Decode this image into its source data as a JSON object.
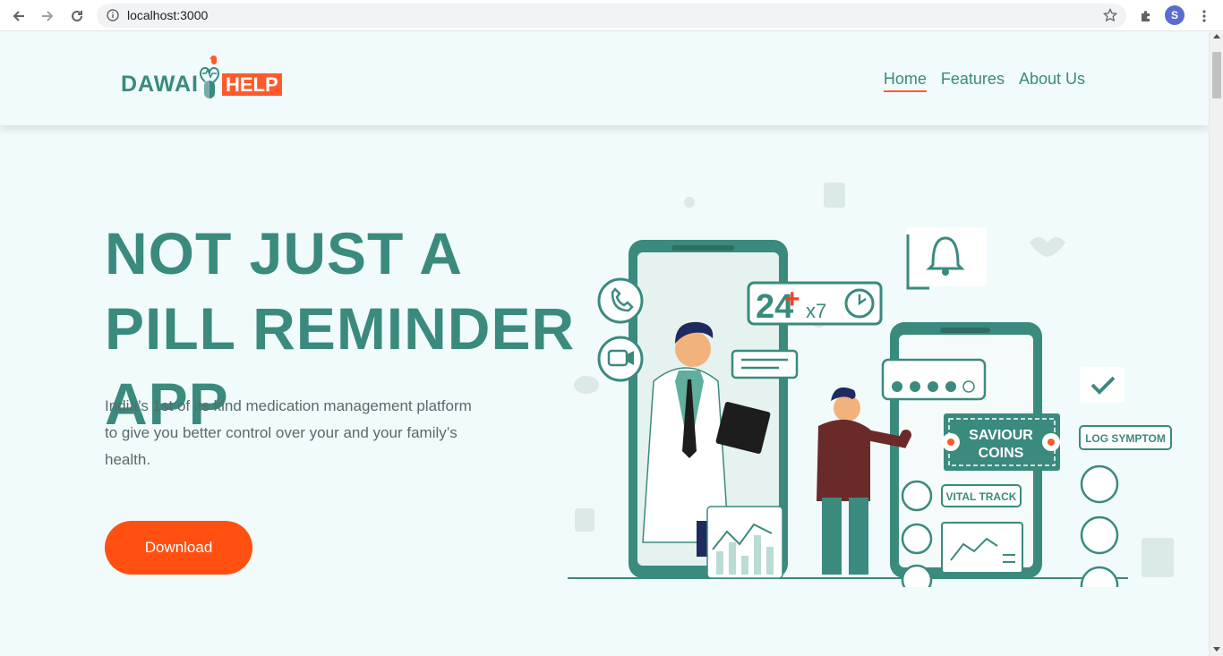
{
  "browser": {
    "url": "localhost:3000",
    "profile_initial": "S"
  },
  "header": {
    "logo": {
      "part1": "DAWAI",
      "part2": "HELP"
    },
    "nav": [
      {
        "label": "Home",
        "active": true
      },
      {
        "label": "Features",
        "active": false
      },
      {
        "label": "About Us",
        "active": false
      }
    ]
  },
  "hero": {
    "title": "NOT JUST A PILL REMINDER APP",
    "description": "India’s 1st of its kind medication management platform to give you better control over your and your family’s health.",
    "download_label": "Download"
  },
  "illustration": {
    "counter_main": "24",
    "counter_mult": "x7",
    "saviour_coins": "SAVIOUR COINS",
    "vital_track": "VITAL TRACK",
    "log_symptom": "LOG SYMPTOM"
  },
  "colors": {
    "brand": "#3a8a7e",
    "accent": "#ff5012",
    "background": "#f1fbfb"
  }
}
